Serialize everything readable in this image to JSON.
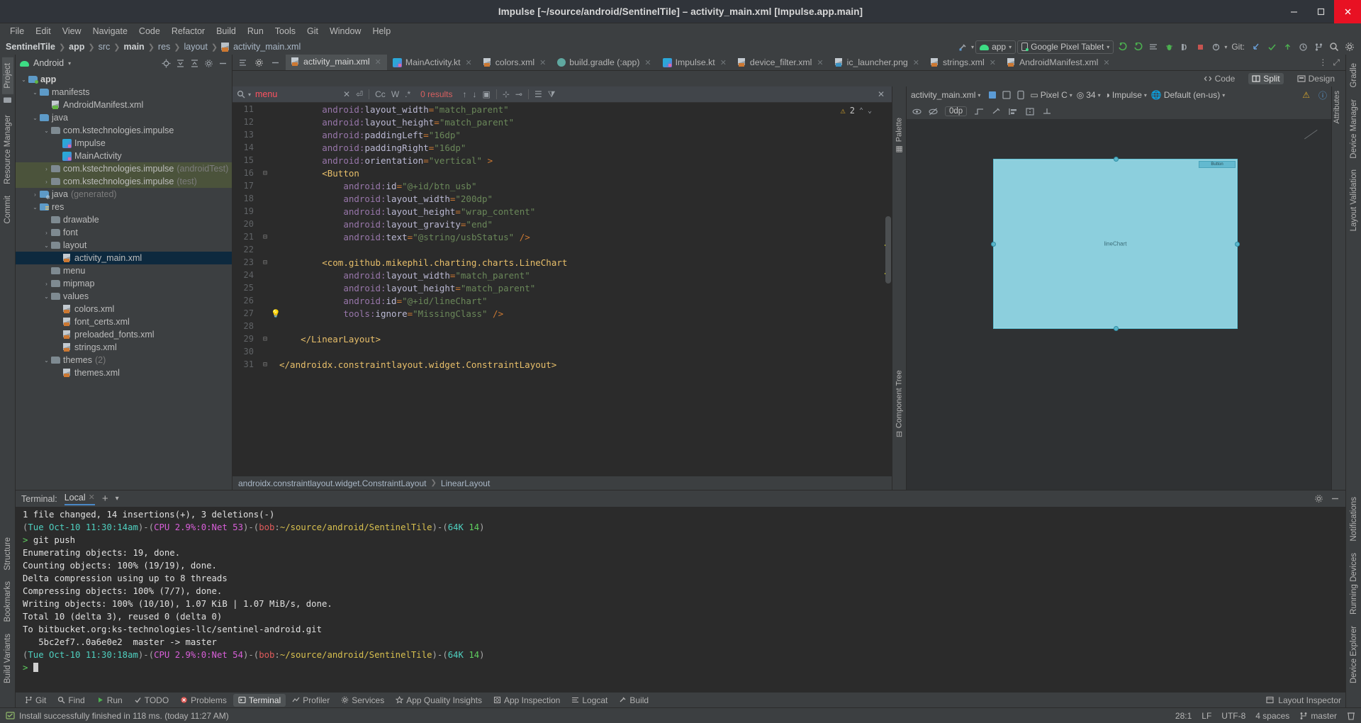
{
  "window": {
    "title": "Impulse [~/source/android/SentinelTile] – activity_main.xml [Impulse.app.main]",
    "minimize": "–",
    "maximize": "□",
    "close": "✕"
  },
  "menubar": [
    "File",
    "Edit",
    "View",
    "Navigate",
    "Code",
    "Refactor",
    "Build",
    "Run",
    "Tools",
    "Git",
    "Window",
    "Help"
  ],
  "breadcrumb": [
    "SentinelTile",
    "app",
    "src",
    "main",
    "res",
    "layout",
    "activity_main.xml"
  ],
  "toolbar": {
    "build_variant": "app",
    "device": "Google Pixel Tablet",
    "git_label": "Git:",
    "search_icon": "search-icon",
    "settings_icon": "gear-icon"
  },
  "project": {
    "scope": "Android",
    "tree": [
      {
        "depth": 0,
        "tw": "v",
        "icon": "folder-module",
        "label": "app",
        "bold": true
      },
      {
        "depth": 1,
        "tw": "v",
        "icon": "folder-blue",
        "label": "manifests"
      },
      {
        "depth": 2,
        "tw": "",
        "icon": "xml-mf",
        "label": "AndroidManifest.xml"
      },
      {
        "depth": 1,
        "tw": "v",
        "icon": "folder-blue",
        "label": "java"
      },
      {
        "depth": 2,
        "tw": "v",
        "icon": "folder-pkg",
        "label": "com.kstechnologies.impulse"
      },
      {
        "depth": 3,
        "tw": "",
        "icon": "kotlin",
        "label": "Impulse"
      },
      {
        "depth": 3,
        "tw": "",
        "icon": "kotlin",
        "label": "MainActivity"
      },
      {
        "depth": 2,
        "tw": ">",
        "icon": "folder-pkg",
        "label": "com.kstechnologies.impulse",
        "dim": "(androidTest)",
        "green": true
      },
      {
        "depth": 2,
        "tw": ">",
        "icon": "folder-pkg",
        "label": "com.kstechnologies.impulse",
        "dim": "(test)",
        "green": true
      },
      {
        "depth": 1,
        "tw": ">",
        "icon": "folder-gen",
        "label": "java",
        "dim": "(generated)"
      },
      {
        "depth": 1,
        "tw": "v",
        "icon": "folder-res",
        "label": "res"
      },
      {
        "depth": 2,
        "tw": "",
        "icon": "folder-pkg",
        "label": "drawable"
      },
      {
        "depth": 2,
        "tw": ">",
        "icon": "folder-pkg",
        "label": "font"
      },
      {
        "depth": 2,
        "tw": "v",
        "icon": "folder-pkg",
        "label": "layout"
      },
      {
        "depth": 3,
        "tw": "",
        "icon": "xml",
        "label": "activity_main.xml",
        "selected": true
      },
      {
        "depth": 2,
        "tw": "",
        "icon": "folder-pkg",
        "label": "menu"
      },
      {
        "depth": 2,
        "tw": ">",
        "icon": "folder-pkg",
        "label": "mipmap"
      },
      {
        "depth": 2,
        "tw": "v",
        "icon": "folder-pkg",
        "label": "values"
      },
      {
        "depth": 3,
        "tw": "",
        "icon": "xml",
        "label": "colors.xml"
      },
      {
        "depth": 3,
        "tw": "",
        "icon": "xml",
        "label": "font_certs.xml"
      },
      {
        "depth": 3,
        "tw": "",
        "icon": "xml",
        "label": "preloaded_fonts.xml"
      },
      {
        "depth": 3,
        "tw": "",
        "icon": "xml",
        "label": "strings.xml"
      },
      {
        "depth": 2,
        "tw": "v",
        "icon": "folder-pkg",
        "label": "themes",
        "dim": "(2)"
      },
      {
        "depth": 3,
        "tw": "",
        "icon": "xml",
        "label": "themes.xml"
      }
    ]
  },
  "left_strip": [
    "Project",
    "Resource Manager",
    "Commit",
    "Structure",
    "Bookmarks",
    "Build Variants"
  ],
  "right_strip": [
    "Gradle",
    "Device Manager",
    "Layout Validation",
    "Notifications",
    "Running Devices",
    "Device Explorer"
  ],
  "tabs": [
    {
      "label": "activity_main.xml",
      "icon": "xml",
      "active": true
    },
    {
      "label": "MainActivity.kt",
      "icon": "kotlin"
    },
    {
      "label": "colors.xml",
      "icon": "xml"
    },
    {
      "label": "build.gradle (:app)",
      "icon": "gradle"
    },
    {
      "label": "Impulse.kt",
      "icon": "kotlin"
    },
    {
      "label": "device_filter.xml",
      "icon": "xml"
    },
    {
      "label": "ic_launcher.png",
      "icon": "png"
    },
    {
      "label": "strings.xml",
      "icon": "xml"
    },
    {
      "label": "AndroidManifest.xml",
      "icon": "xml"
    }
  ],
  "mode": {
    "code": "Code",
    "split": "Split",
    "design": "Design",
    "active": "Split"
  },
  "find": {
    "query": "menu",
    "results": "0 results",
    "match_case": "Cc",
    "words": "W",
    "regex": ".*"
  },
  "editor": {
    "warnings": "2",
    "status_path": [
      "androidx.constraintlayout.widget.ConstraintLayout",
      "LinearLayout"
    ],
    "lines": [
      {
        "n": 11,
        "indent": 8,
        "parts": [
          {
            "t": "android:",
            "c": "ns"
          },
          {
            "t": "layout_width",
            "c": "attr"
          },
          {
            "t": "=",
            "c": "op"
          },
          {
            "t": "\"match_parent\"",
            "c": "val"
          }
        ]
      },
      {
        "n": 12,
        "indent": 8,
        "parts": [
          {
            "t": "android:",
            "c": "ns"
          },
          {
            "t": "layout_height",
            "c": "attr"
          },
          {
            "t": "=",
            "c": "op"
          },
          {
            "t": "\"match_parent\"",
            "c": "val"
          }
        ]
      },
      {
        "n": 13,
        "indent": 8,
        "parts": [
          {
            "t": "android:",
            "c": "ns"
          },
          {
            "t": "paddingLeft",
            "c": "attr"
          },
          {
            "t": "=",
            "c": "op"
          },
          {
            "t": "\"16dp\"",
            "c": "val"
          }
        ]
      },
      {
        "n": 14,
        "indent": 8,
        "parts": [
          {
            "t": "android:",
            "c": "ns"
          },
          {
            "t": "paddingRight",
            "c": "attr"
          },
          {
            "t": "=",
            "c": "op"
          },
          {
            "t": "\"16dp\"",
            "c": "val"
          }
        ]
      },
      {
        "n": 15,
        "indent": 8,
        "parts": [
          {
            "t": "android:",
            "c": "ns"
          },
          {
            "t": "orientation",
            "c": "attr"
          },
          {
            "t": "=",
            "c": "op"
          },
          {
            "t": "\"vertical\" ",
            "c": "val"
          },
          {
            "t": ">",
            "c": "op"
          }
        ]
      },
      {
        "n": 16,
        "indent": 8,
        "fold": true,
        "parts": [
          {
            "t": "<Button",
            "c": "tag"
          }
        ]
      },
      {
        "n": 17,
        "indent": 12,
        "parts": [
          {
            "t": "android:",
            "c": "ns"
          },
          {
            "t": "id",
            "c": "attr"
          },
          {
            "t": "=",
            "c": "op"
          },
          {
            "t": "\"@+id/btn_usb\"",
            "c": "val"
          }
        ]
      },
      {
        "n": 18,
        "indent": 12,
        "parts": [
          {
            "t": "android:",
            "c": "ns"
          },
          {
            "t": "layout_width",
            "c": "attr"
          },
          {
            "t": "=",
            "c": "op"
          },
          {
            "t": "\"200dp\"",
            "c": "val"
          }
        ]
      },
      {
        "n": 19,
        "indent": 12,
        "parts": [
          {
            "t": "android:",
            "c": "ns"
          },
          {
            "t": "layout_height",
            "c": "attr"
          },
          {
            "t": "=",
            "c": "op"
          },
          {
            "t": "\"wrap_content\"",
            "c": "val"
          }
        ]
      },
      {
        "n": 20,
        "indent": 12,
        "parts": [
          {
            "t": "android:",
            "c": "ns"
          },
          {
            "t": "layout_gravity",
            "c": "attr"
          },
          {
            "t": "=",
            "c": "op"
          },
          {
            "t": "\"end\"",
            "c": "val"
          }
        ]
      },
      {
        "n": 21,
        "indent": 12,
        "fold": true,
        "parts": [
          {
            "t": "android:",
            "c": "ns"
          },
          {
            "t": "text",
            "c": "attr"
          },
          {
            "t": "=",
            "c": "op"
          },
          {
            "t": "\"@string/usbStatus\" ",
            "c": "val"
          },
          {
            "t": "/>",
            "c": "op"
          }
        ]
      },
      {
        "n": 22,
        "indent": 0,
        "parts": []
      },
      {
        "n": 23,
        "indent": 8,
        "fold": true,
        "parts": [
          {
            "t": "<com.github.mikephil.charting.charts.LineChart",
            "c": "tag"
          }
        ]
      },
      {
        "n": 24,
        "indent": 12,
        "parts": [
          {
            "t": "android:",
            "c": "ns"
          },
          {
            "t": "layout_width",
            "c": "attr"
          },
          {
            "t": "=",
            "c": "op"
          },
          {
            "t": "\"match_parent\"",
            "c": "val"
          }
        ]
      },
      {
        "n": 25,
        "indent": 12,
        "parts": [
          {
            "t": "android:",
            "c": "ns"
          },
          {
            "t": "layout_height",
            "c": "attr"
          },
          {
            "t": "=",
            "c": "op"
          },
          {
            "t": "\"match_parent\"",
            "c": "val"
          }
        ]
      },
      {
        "n": 26,
        "indent": 12,
        "parts": [
          {
            "t": "android:",
            "c": "ns"
          },
          {
            "t": "id",
            "c": "attr"
          },
          {
            "t": "=",
            "c": "op"
          },
          {
            "t": "\"@+id/lineChart\"",
            "c": "val"
          }
        ]
      },
      {
        "n": 27,
        "indent": 12,
        "bulb": true,
        "parts": [
          {
            "t": "tools:",
            "c": "ns"
          },
          {
            "t": "ignore",
            "c": "attr"
          },
          {
            "t": "=",
            "c": "op"
          },
          {
            "t": "\"MissingClass\" ",
            "c": "val"
          },
          {
            "t": "/>",
            "c": "op"
          }
        ]
      },
      {
        "n": 28,
        "indent": 0,
        "parts": []
      },
      {
        "n": 29,
        "indent": 4,
        "fold": true,
        "parts": [
          {
            "t": "</LinearLayout>",
            "c": "tag"
          }
        ]
      },
      {
        "n": 30,
        "indent": 0,
        "parts": []
      },
      {
        "n": 31,
        "indent": 0,
        "fold": true,
        "parts": [
          {
            "t": "</androidx.constraintlayout.widget.ConstraintLayout>",
            "c": "tag"
          }
        ]
      }
    ]
  },
  "preview": {
    "file": "activity_main.xml",
    "density": "0dp",
    "device": "Pixel C",
    "api": "34",
    "theme": "Impulse",
    "locale": "Default (en-us)",
    "palette": "Palette",
    "attributes": "Attributes",
    "component_tree": "Component Tree",
    "button_label": "Button",
    "chart_label": "lineChart"
  },
  "terminal": {
    "label": "Terminal:",
    "tab": "Local",
    "lines": [
      {
        "segs": [
          {
            "t": "1 file changed, 14 insertions(+), 3 deletions(-)",
            "c": "wh"
          }
        ]
      },
      {
        "segs": [
          {
            "t": "(",
            "c": "gray"
          },
          {
            "t": "Tue Oct-10 11:30:14am",
            "c": "teal"
          },
          {
            "t": ")-(",
            "c": "gray"
          },
          {
            "t": "CPU 2.9%:0:Net 53",
            "c": "mag"
          },
          {
            "t": ")-(",
            "c": "gray"
          },
          {
            "t": "bob",
            "c": "red"
          },
          {
            "t": ":",
            "c": "gray"
          },
          {
            "t": "~/source/android/SentinelTile",
            "c": "yel"
          },
          {
            "t": ")-(",
            "c": "gray"
          },
          {
            "t": "64K",
            "c": "teal"
          },
          {
            "t": " ",
            "c": "gray"
          },
          {
            "t": "14",
            "c": "grn"
          },
          {
            "t": ")",
            "c": "gray"
          }
        ]
      },
      {
        "segs": [
          {
            "t": "> ",
            "c": "grn"
          },
          {
            "t": "git push",
            "c": "wh"
          }
        ]
      },
      {
        "segs": [
          {
            "t": "Enumerating objects: 19, done.",
            "c": "wh"
          }
        ]
      },
      {
        "segs": [
          {
            "t": "Counting objects: 100% (19/19), done.",
            "c": "wh"
          }
        ]
      },
      {
        "segs": [
          {
            "t": "Delta compression using up to 8 threads",
            "c": "wh"
          }
        ]
      },
      {
        "segs": [
          {
            "t": "Compressing objects: 100% (7/7), done.",
            "c": "wh"
          }
        ]
      },
      {
        "segs": [
          {
            "t": "Writing objects: 100% (10/10), 1.07 KiB | 1.07 MiB/s, done.",
            "c": "wh"
          }
        ]
      },
      {
        "segs": [
          {
            "t": "Total 10 (delta 3), reused 0 (delta 0)",
            "c": "wh"
          }
        ]
      },
      {
        "segs": [
          {
            "t": "To bitbucket.org:ks-technologies-llc/sentinel-android.git",
            "c": "wh"
          }
        ]
      },
      {
        "segs": [
          {
            "t": "   5bc2ef7..0a6e0e2  master -> master",
            "c": "wh"
          }
        ]
      },
      {
        "segs": [
          {
            "t": "(",
            "c": "gray"
          },
          {
            "t": "Tue Oct-10 11:30:18am",
            "c": "teal"
          },
          {
            "t": ")-(",
            "c": "gray"
          },
          {
            "t": "CPU 2.9%:0:Net 54",
            "c": "mag"
          },
          {
            "t": ")-(",
            "c": "gray"
          },
          {
            "t": "bob",
            "c": "red"
          },
          {
            "t": ":",
            "c": "gray"
          },
          {
            "t": "~/source/android/SentinelTile",
            "c": "yel"
          },
          {
            "t": ")-(",
            "c": "gray"
          },
          {
            "t": "64K",
            "c": "teal"
          },
          {
            "t": " ",
            "c": "gray"
          },
          {
            "t": "14",
            "c": "grn"
          },
          {
            "t": ")",
            "c": "gray"
          }
        ]
      },
      {
        "segs": [
          {
            "t": "> ",
            "c": "grn"
          }
        ]
      }
    ]
  },
  "bottom_tabs": [
    {
      "label": "Git",
      "icon": "branch-icon"
    },
    {
      "label": "Find",
      "icon": "search-icon"
    },
    {
      "label": "Run",
      "icon": "play-icon"
    },
    {
      "label": "TODO",
      "icon": "check-icon"
    },
    {
      "label": "Problems",
      "icon": "error-icon"
    },
    {
      "label": "Terminal",
      "icon": "terminal-icon",
      "active": true
    },
    {
      "label": "Profiler",
      "icon": "profiler-icon"
    },
    {
      "label": "Services",
      "icon": "services-icon"
    },
    {
      "label": "App Quality Insights",
      "icon": "insights-icon"
    },
    {
      "label": "App Inspection",
      "icon": "inspection-icon"
    },
    {
      "label": "Logcat",
      "icon": "logcat-icon"
    },
    {
      "label": "Build",
      "icon": "build-icon"
    }
  ],
  "bottom_right": {
    "layout_inspector": "Layout Inspector"
  },
  "status": {
    "message": "Install successfully finished in 118 ms. (today 11:27 AM)",
    "caret": "28:1",
    "line_sep": "LF",
    "encoding": "UTF-8",
    "indent": "4 spaces",
    "branch": "master"
  },
  "colors": {
    "accent": "#4a88c7",
    "android_green": "#3ddc84",
    "warning": "#d6a52b",
    "error": "#e05b5b",
    "selection": "#0d293e",
    "bg": "#3c3f41",
    "editor_bg": "#2b2b2b",
    "close_red": "#e81123"
  }
}
